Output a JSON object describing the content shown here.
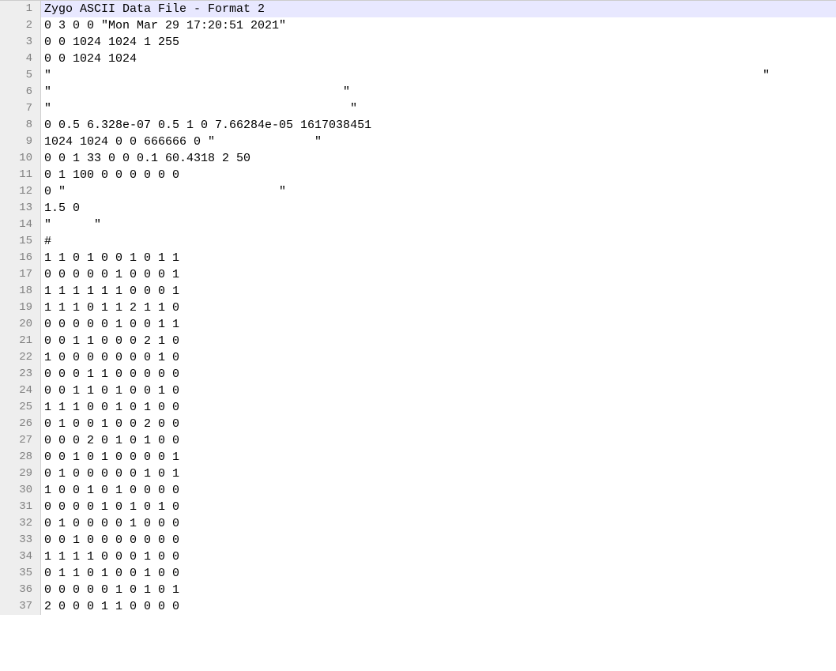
{
  "lines": [
    {
      "num": "1",
      "text": "Zygo ASCII Data File - Format 2"
    },
    {
      "num": "2",
      "text": "0 3 0 0 \"Mon Mar 29 17:20:51 2021\""
    },
    {
      "num": "3",
      "text": "0 0 1024 1024 1 255"
    },
    {
      "num": "4",
      "text": "0 0 1024 1024"
    },
    {
      "num": "5",
      "text": "\"                                                                                                    \""
    },
    {
      "num": "6",
      "text": "\"                                         \""
    },
    {
      "num": "7",
      "text": "\"                                          \""
    },
    {
      "num": "8",
      "text": "0 0.5 6.328e-07 0.5 1 0 7.66284e-05 1617038451"
    },
    {
      "num": "9",
      "text": "1024 1024 0 0 666666 0 \"              \""
    },
    {
      "num": "10",
      "text": "0 0 1 33 0 0 0.1 60.4318 2 50"
    },
    {
      "num": "11",
      "text": "0 1 100 0 0 0 0 0 0"
    },
    {
      "num": "12",
      "text": "0 \"                              \""
    },
    {
      "num": "13",
      "text": "1.5 0"
    },
    {
      "num": "14",
      "text": "\"      \""
    },
    {
      "num": "15",
      "text": "#"
    },
    {
      "num": "16",
      "text": "1 1 0 1 0 0 1 0 1 1"
    },
    {
      "num": "17",
      "text": "0 0 0 0 0 1 0 0 0 1"
    },
    {
      "num": "18",
      "text": "1 1 1 1 1 1 0 0 0 1"
    },
    {
      "num": "19",
      "text": "1 1 1 0 1 1 2 1 1 0"
    },
    {
      "num": "20",
      "text": "0 0 0 0 0 1 0 0 1 1"
    },
    {
      "num": "21",
      "text": "0 0 1 1 0 0 0 2 1 0"
    },
    {
      "num": "22",
      "text": "1 0 0 0 0 0 0 0 1 0"
    },
    {
      "num": "23",
      "text": "0 0 0 1 1 0 0 0 0 0"
    },
    {
      "num": "24",
      "text": "0 0 1 1 0 1 0 0 1 0"
    },
    {
      "num": "25",
      "text": "1 1 1 0 0 1 0 1 0 0"
    },
    {
      "num": "26",
      "text": "0 1 0 0 1 0 0 2 0 0"
    },
    {
      "num": "27",
      "text": "0 0 0 2 0 1 0 1 0 0"
    },
    {
      "num": "28",
      "text": "0 0 1 0 1 0 0 0 0 1"
    },
    {
      "num": "29",
      "text": "0 1 0 0 0 0 0 1 0 1"
    },
    {
      "num": "30",
      "text": "1 0 0 1 0 1 0 0 0 0"
    },
    {
      "num": "31",
      "text": "0 0 0 0 1 0 1 0 1 0"
    },
    {
      "num": "32",
      "text": "0 1 0 0 0 0 1 0 0 0"
    },
    {
      "num": "33",
      "text": "0 0 1 0 0 0 0 0 0 0"
    },
    {
      "num": "34",
      "text": "1 1 1 1 0 0 0 1 0 0"
    },
    {
      "num": "35",
      "text": "0 1 1 0 1 0 0 1 0 0"
    },
    {
      "num": "36",
      "text": "0 0 0 0 0 1 0 1 0 1"
    },
    {
      "num": "37",
      "text": "2 0 0 0 1 1 0 0 0 0"
    }
  ]
}
